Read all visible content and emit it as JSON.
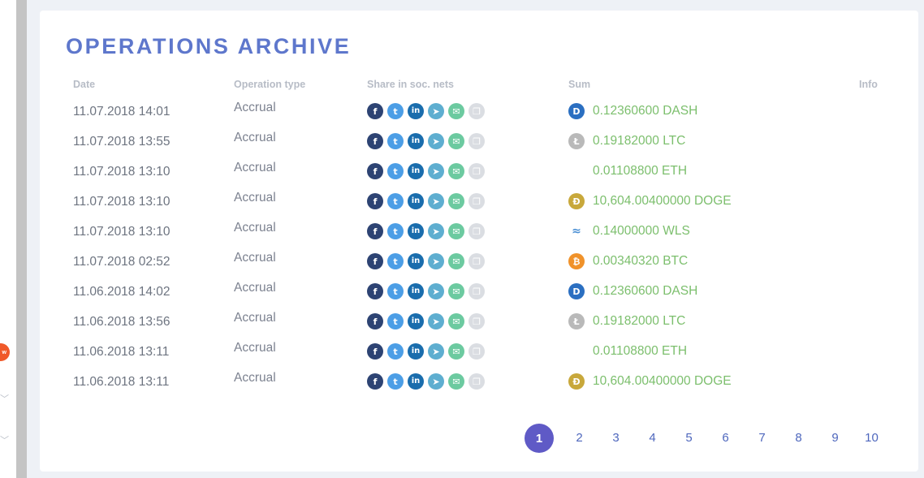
{
  "title": "OPERATIONS ARCHIVE",
  "columns": {
    "date": "Date",
    "type": "Operation type",
    "share": "Share in soc. nets",
    "sum": "Sum",
    "info": "Info"
  },
  "share_icons": [
    "facebook-icon",
    "twitter-icon",
    "linkedin-icon",
    "telegram-icon",
    "email-icon",
    "copy-icon"
  ],
  "share_glyphs": [
    "f",
    "t",
    "in",
    "➤",
    "✉",
    "❐"
  ],
  "rows": [
    {
      "date": "11.07.2018 14:01",
      "type": "Accrual",
      "coin": "dash",
      "sum": "0.12360600 DASH"
    },
    {
      "date": "11.07.2018 13:55",
      "type": "Accrual",
      "coin": "ltc",
      "sum": "0.19182000 LTC"
    },
    {
      "date": "11.07.2018 13:10",
      "type": "Accrual",
      "coin": "eth",
      "sum": "0.01108800 ETH"
    },
    {
      "date": "11.07.2018 13:10",
      "type": "Accrual",
      "coin": "doge",
      "sum": "10,604.00400000 DOGE"
    },
    {
      "date": "11.07.2018 13:10",
      "type": "Accrual",
      "coin": "wls",
      "sum": "0.14000000 WLS"
    },
    {
      "date": "11.07.2018 02:52",
      "type": "Accrual",
      "coin": "btc",
      "sum": "0.00340320 BTC"
    },
    {
      "date": "11.06.2018 14:02",
      "type": "Accrual",
      "coin": "dash",
      "sum": "0.12360600 DASH"
    },
    {
      "date": "11.06.2018 13:56",
      "type": "Accrual",
      "coin": "ltc",
      "sum": "0.19182000 LTC"
    },
    {
      "date": "11.06.2018 13:11",
      "type": "Accrual",
      "coin": "eth",
      "sum": "0.01108800 ETH"
    },
    {
      "date": "11.06.2018 13:11",
      "type": "Accrual",
      "coin": "doge",
      "sum": "10,604.00400000 DOGE"
    }
  ],
  "coin_glyphs": {
    "dash": "D",
    "ltc": "Ł",
    "eth": "◆",
    "doge": "Đ",
    "wls": "≈",
    "btc": "₿"
  },
  "pages": [
    "1",
    "2",
    "3",
    "4",
    "5",
    "6",
    "7",
    "8",
    "9",
    "10"
  ],
  "active_page": "1",
  "colors": {
    "title": "#5e77cc",
    "sum": "#7cbf6d",
    "active_page": "#5f5ac6"
  }
}
